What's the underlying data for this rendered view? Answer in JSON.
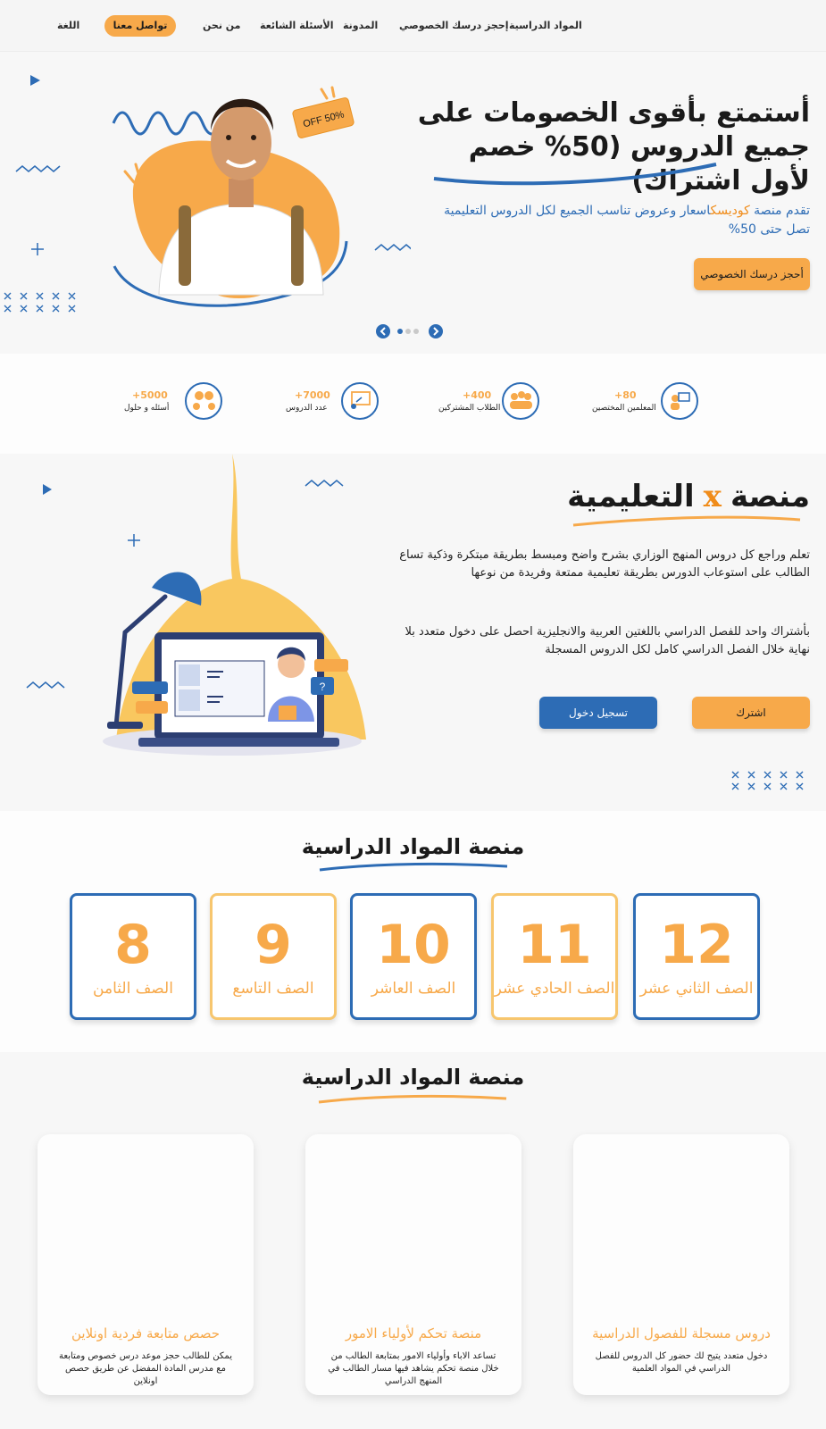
{
  "nav": {
    "items": [
      "المواد الدراسية",
      "إحجز درسك الخصوصي",
      "المدونة",
      "الأسئلة الشائعة",
      "من نحن"
    ],
    "contact_button": "تواصل معنا",
    "language": "اللغة"
  },
  "hero": {
    "title": "أستمتع بأقوى الخصومات على جميع الدروس (50% خصم لأول اشتراك)",
    "subtitle_pre": "تقدم منصة ",
    "subtitle_brand": "كوديسك",
    "subtitle_post": "اسعار وعروض تناسب الجميع لكل الدروس التعليمية تصل حتى 50%",
    "badge": "50% OFF",
    "cta": "أحجز درسك الخصوصي"
  },
  "stats": [
    {
      "number": "80+",
      "label": "المعلمين المختصين",
      "icon": "teacher-icon"
    },
    {
      "number": "400+",
      "label": "الطلاب المشتركين",
      "icon": "students-icon"
    },
    {
      "number": "7000+",
      "label": "عدد الدروس",
      "icon": "lesson-board-icon"
    },
    {
      "number": "5000+",
      "label": "أسئله و حلول",
      "icon": "qa-icon"
    }
  ],
  "about": {
    "title_pre": "منصة",
    "title_x": "x",
    "title_post": "التعليمية",
    "paragraph1": "تعلم وراجع كل دروس المنهج الوزاري بشرح واضح ومبسط بطريقة مبتكرة وذكية تساع الطالب على استوعاب الدورس بطريقة تعليمية ممتعة وفريدة من نوعها",
    "paragraph2": "بأشتراك واحد للفصل الدراسي باللغتين العربية والانجليزية احصل على دخول متعدد بلا نهاية خلال الفصل الدراسي كامل لكل الدروس المسجلة",
    "subscribe": "اشترك",
    "login": "تسجيل دخول"
  },
  "grades": {
    "title": "منصة المواد الدراسية",
    "items": [
      {
        "number": "12",
        "label": "الصف الثاني عشر"
      },
      {
        "number": "11",
        "label": "الصف الحادي عشر"
      },
      {
        "number": "10",
        "label": "الصف العاشر"
      },
      {
        "number": "9",
        "label": "الصف التاسع"
      },
      {
        "number": "8",
        "label": "الصف الثامن"
      }
    ]
  },
  "features": {
    "title": "منصة المواد الدراسية",
    "items": [
      {
        "title": "دروس مسجلة للفصول الدراسية",
        "desc": "دخول متعدد يتيح لك حضور كل الدروس للفصل الدراسي في المواد العلمية"
      },
      {
        "title": "منصة تحكم لأولياء الامور",
        "desc": "تساعد الاباء وأولياء الامور بمتابعة الطالب من خلال منصة تحكم يشاهد فيها مسار الطالب في المنهج الدراسي"
      },
      {
        "title": "حصص متابعة فردية اونلاين",
        "desc": "يمكن للطالب حجز موعد درس خصوص ومتابعة مع مدرس المادة المفضل عن طريق حصص اونلاين"
      }
    ]
  },
  "colors": {
    "accent": "#f7a94a",
    "brand_blue": "#2d6cb5",
    "brand_orange": "#f08c1a"
  }
}
